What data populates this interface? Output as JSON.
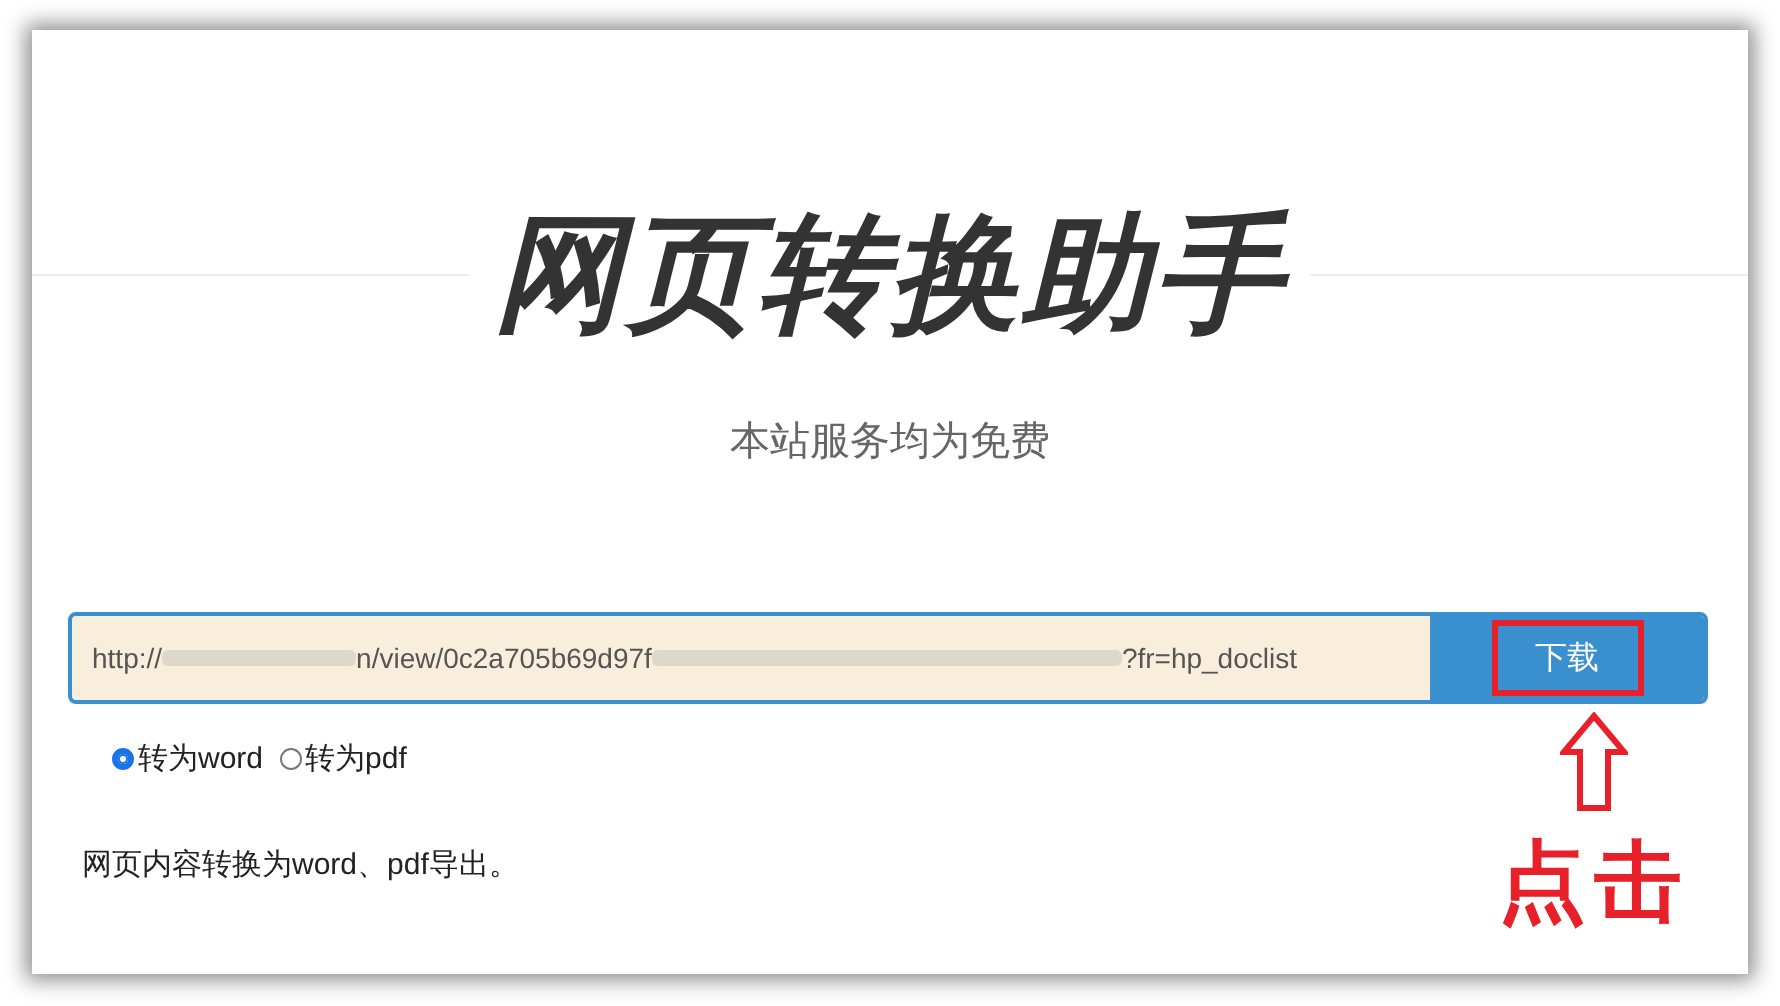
{
  "title": "网页转换助手",
  "subtitle": "本站服务均为免费",
  "url_field": {
    "segments": [
      {
        "kind": "text",
        "text": "http://"
      },
      {
        "kind": "redacted"
      },
      {
        "kind": "text",
        "text": "n/view/0c2a705b69d97f"
      },
      {
        "kind": "redacted"
      },
      {
        "kind": "text",
        "text": "?fr=hp_doclist"
      }
    ]
  },
  "download_button": {
    "label": "下载",
    "highlighted": true
  },
  "formats": [
    {
      "label": "转为word",
      "selected": true
    },
    {
      "label": "转为pdf",
      "selected": false
    }
  ],
  "description": "网页内容转换为word、pdf导出。",
  "annotation": {
    "label": "点击"
  }
}
